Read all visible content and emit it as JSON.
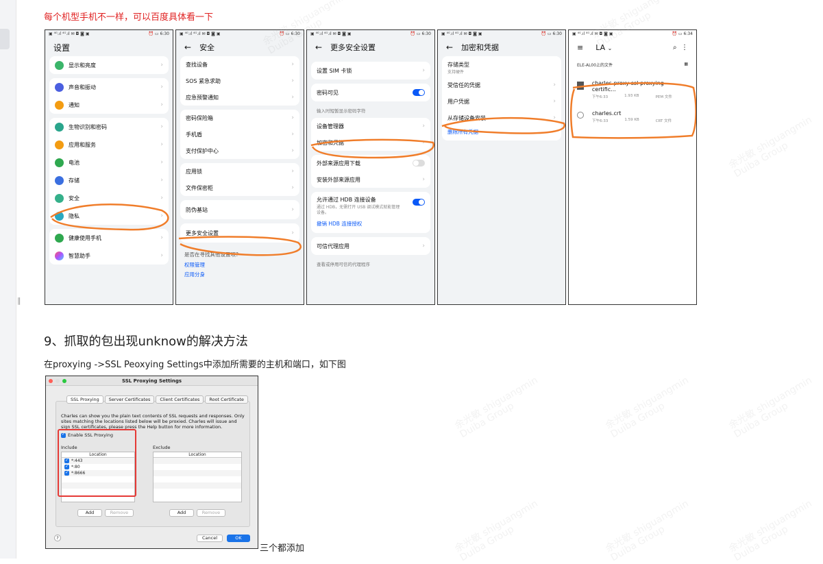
{
  "note": "每个机型手机不一样，可以百度具体看一下",
  "status": {
    "time1": "6:30",
    "time2": "6:34",
    "left": "▣ ⁴ᴳ.ıl ⁴ᴳ.ıl ✉ ◘ ◙ ▣",
    "right": "⏰ ▭"
  },
  "phone1": {
    "title": "设置",
    "items": [
      "显示和亮度",
      "声音和振动",
      "通知",
      "生物识别和密码",
      "应用和服务",
      "电池",
      "存储",
      "安全",
      "隐私",
      "健康使用手机",
      "智慧助手"
    ]
  },
  "phone2": {
    "title": "安全",
    "back": "←",
    "groups": [
      [
        "查找设备",
        "SOS 紧急求助",
        "应急预警通知"
      ],
      [
        "密码保险箱",
        "手机盾",
        "支付保护中心"
      ],
      [
        "应用锁",
        "文件保密柜"
      ],
      [
        "防伪基站"
      ],
      [
        "更多安全设置"
      ]
    ],
    "footer_q": "是否在寻找其他设置项?",
    "footer_links": [
      "权限管理",
      "应用分身"
    ]
  },
  "phone3": {
    "title": "更多安全设置",
    "items": [
      "设置 SIM 卡锁",
      "密码可见",
      "设备管理器",
      "加密和凭据",
      "外部来源应用下载",
      "安装外部来源应用",
      "允许通过 HDB 连接设备",
      "可信代理应用"
    ],
    "hint1": "输入时短暂显示密码字符",
    "hdb_desc": "通过 HDB，无需打开 USB 调试模式就能管理设备。",
    "hdb_link": "撤销 HDB 连接授权",
    "hint2": "查看或停用可信的代理程序"
  },
  "phone4": {
    "title": "加密和凭据",
    "storage_type": "存储类型",
    "storage_sub": "支持硬件",
    "items": [
      "受信任的凭据",
      "用户凭据",
      "从存储设备安装"
    ],
    "delete_link": "删除所有凭据"
  },
  "phone5": {
    "menu": "≡",
    "title": "LA",
    "folder": "ELE-AL00上的文件",
    "files": [
      {
        "name": "charles-proxy-ssl-proxying-certific...",
        "time": "下午6:33",
        "size": "1.93 KB",
        "type": "PEM 文件"
      },
      {
        "name": "charles.crt",
        "time": "下午6:33",
        "size": "1.59 KB",
        "type": "CRT 文件"
      }
    ]
  },
  "heading": "9、抓取的包出现unknow的解决方法",
  "paragraph": "在proxying ->SSL Peoxying Settings中添加所需要的主机和端口，如下图",
  "dialog": {
    "title": "SSL Proxying Settings",
    "tabs": [
      "SSL Proxying",
      "Server Certificates",
      "Client Certificates",
      "Root Certificate"
    ],
    "description": "Charles can show you the plain text contents of SSL requests and responses. Only sites matching the locations listed below will be proxied. Charles will issue and sign SSL certificates, please press the Help button for more information.",
    "enable_label": "Enable SSL Proxying",
    "include_label": "Include",
    "exclude_label": "Exclude",
    "location_header": "Location",
    "include_rows": [
      "*:443",
      "*:80",
      "*:8666"
    ],
    "add_label": "Add",
    "remove_label": "Remove",
    "help_label": "?",
    "cancel_label": "Cancel",
    "ok_label": "OK"
  },
  "caption": "三个都添加",
  "colors": {
    "accent_orange": "#f07d2a",
    "red": "#e02020",
    "blue": "#0a59f7"
  },
  "watermark": {
    "line1": "余光敏 shiguangmin",
    "line2": "Duiba Group"
  }
}
